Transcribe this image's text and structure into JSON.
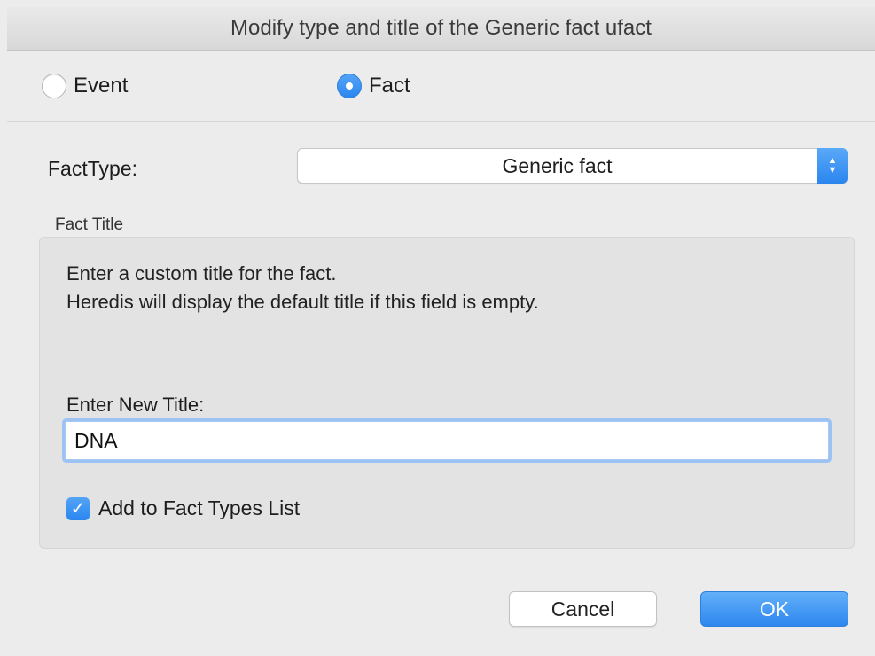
{
  "window": {
    "title": "Modify type and title of the Generic fact ufact"
  },
  "radios": {
    "event_label": "Event",
    "fact_label": "Fact",
    "selected": "Fact"
  },
  "fact_type": {
    "label": "FactType:",
    "value": "Generic fact"
  },
  "fact_title_group": {
    "title": "Fact Title",
    "info_line1": "Enter a custom title for the fact.",
    "info_line2": "Heredis will display the default title if this field is empty.",
    "new_title_label": "Enter New Title:",
    "new_title_value": "DNA",
    "checkbox_label": "Add to Fact Types List",
    "checkbox_checked": true
  },
  "buttons": {
    "cancel": "Cancel",
    "ok": "OK"
  },
  "colors": {
    "accent": "#2a86ee",
    "window_bg": "#ececec"
  },
  "icons": {
    "stepper": "chevron-up-down-icon",
    "checkmark": "checkmark-icon"
  }
}
